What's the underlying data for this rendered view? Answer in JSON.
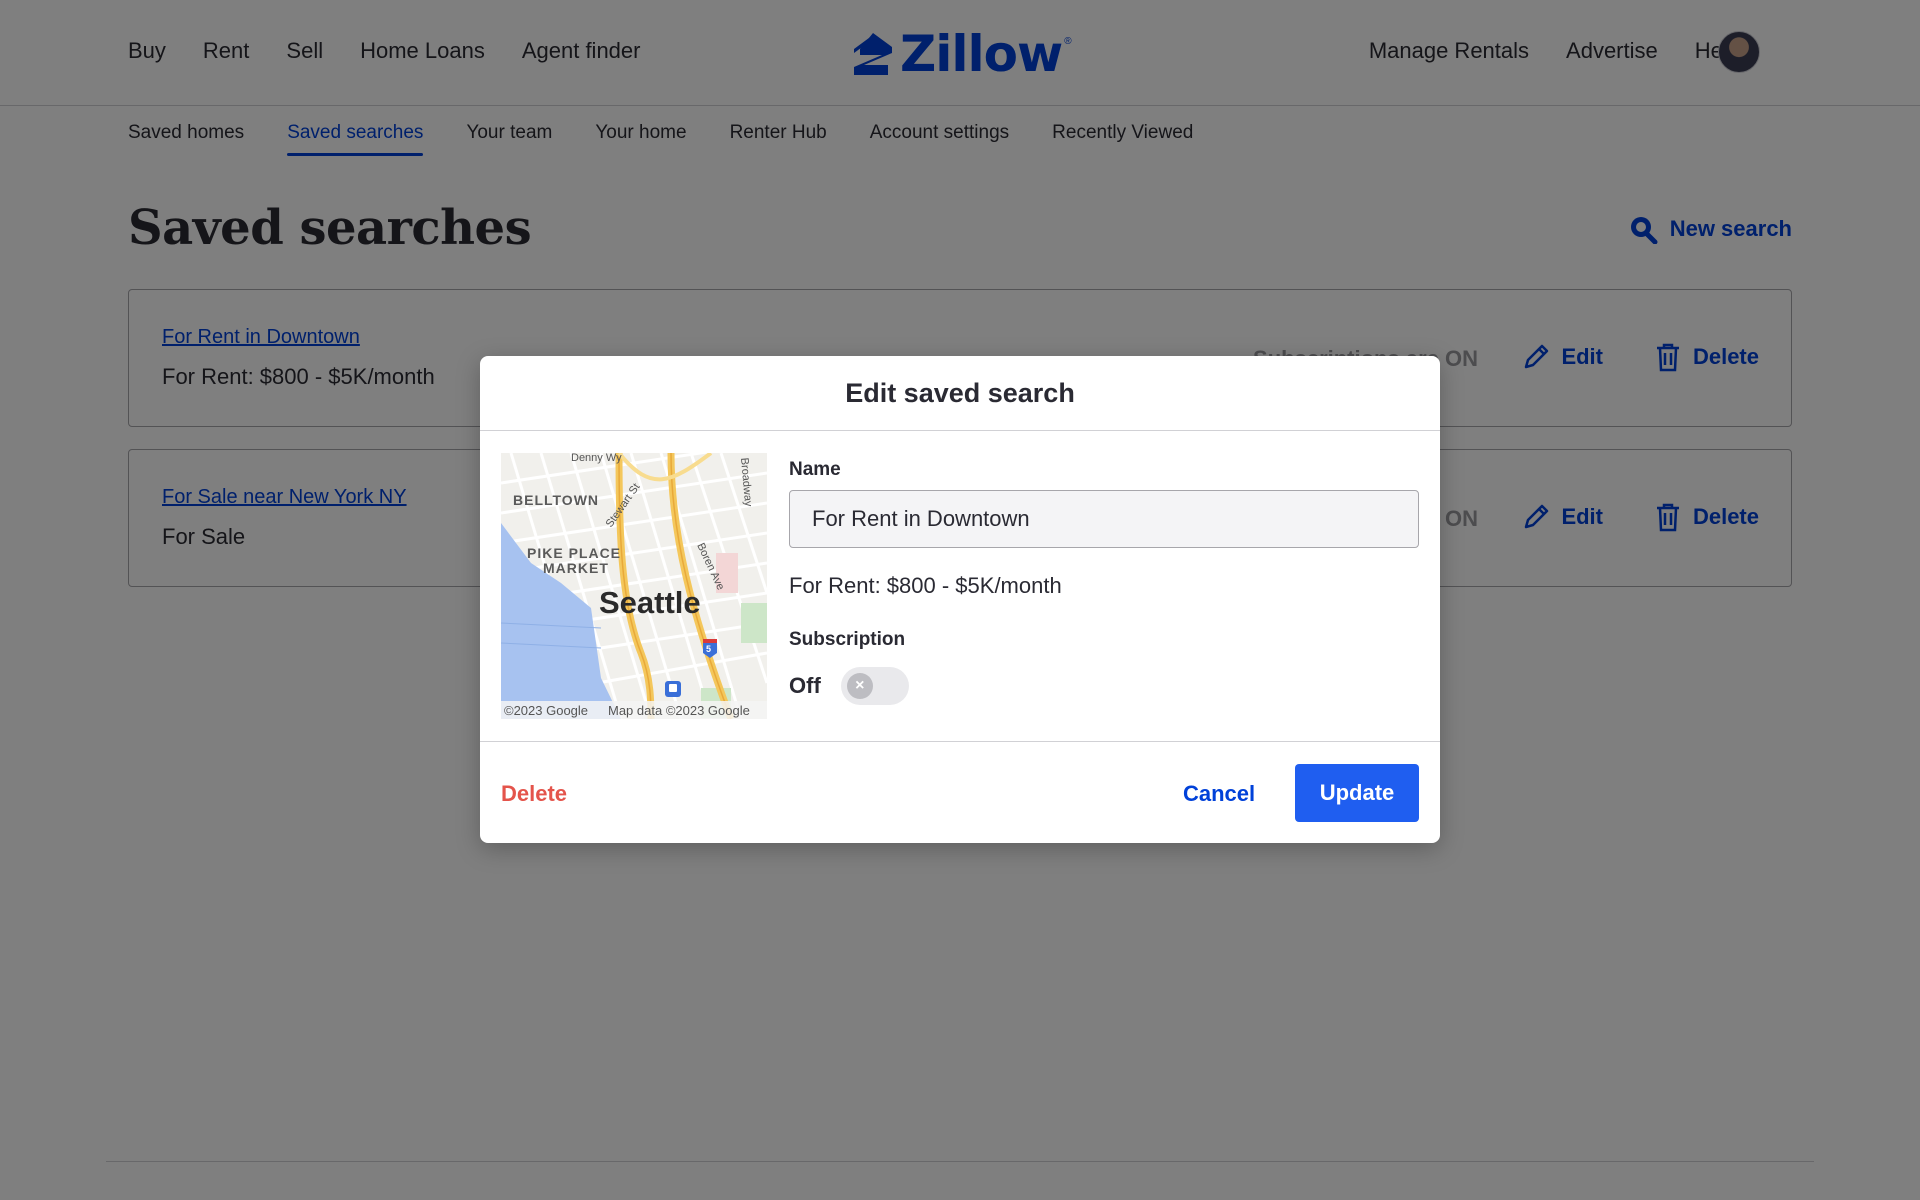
{
  "header": {
    "nav_left": [
      "Buy",
      "Rent",
      "Sell",
      "Home Loans",
      "Agent finder"
    ],
    "logo_text": "Zillow",
    "logo_mark": "®",
    "nav_right": [
      "Manage Rentals",
      "Advertise",
      "Help"
    ],
    "avatar_icon": "user-avatar"
  },
  "subnav": {
    "tabs": [
      "Saved homes",
      "Saved searches",
      "Your team",
      "Your home",
      "Renter Hub",
      "Account settings",
      "Recently Viewed"
    ],
    "active": "Saved searches"
  },
  "page": {
    "title": "Saved searches",
    "new_search_label": "New search",
    "new_search_icon": "search-icon"
  },
  "saved_searches": [
    {
      "title": "For Rent in Downtown",
      "subtitle": "For Rent: $800 - $5K/month",
      "status": "Subscriptions are ON",
      "edit_label": "Edit",
      "delete_label": "Delete"
    },
    {
      "title": "For Sale near New York NY",
      "subtitle": "For Sale",
      "status": "Subscriptions are ON",
      "edit_label": "Edit",
      "delete_label": "Delete"
    }
  ],
  "modal": {
    "title": "Edit saved search",
    "map": {
      "city_label": "Seattle",
      "labels": [
        "Denny Wy",
        "BELLTOWN",
        "Stewart St",
        "Broadway",
        "PIKE PLACE",
        "MARKET",
        "Boren Ave",
        "5"
      ],
      "attribution_left": "©2023 Google",
      "attribution_right": "Map data ©2023 Google"
    },
    "name_label": "Name",
    "name_value": "For Rent in Downtown",
    "description": "For Rent: $800 - $5K/month",
    "subscription_label": "Subscription",
    "subscription_state": "Off",
    "subscription_on": false,
    "delete_label": "Delete",
    "cancel_label": "Cancel",
    "update_label": "Update"
  },
  "colors": {
    "brand_blue": "#0041d9",
    "button_blue": "#1f5ef0",
    "danger_red": "#e4544b",
    "text": "#2a2a33"
  }
}
